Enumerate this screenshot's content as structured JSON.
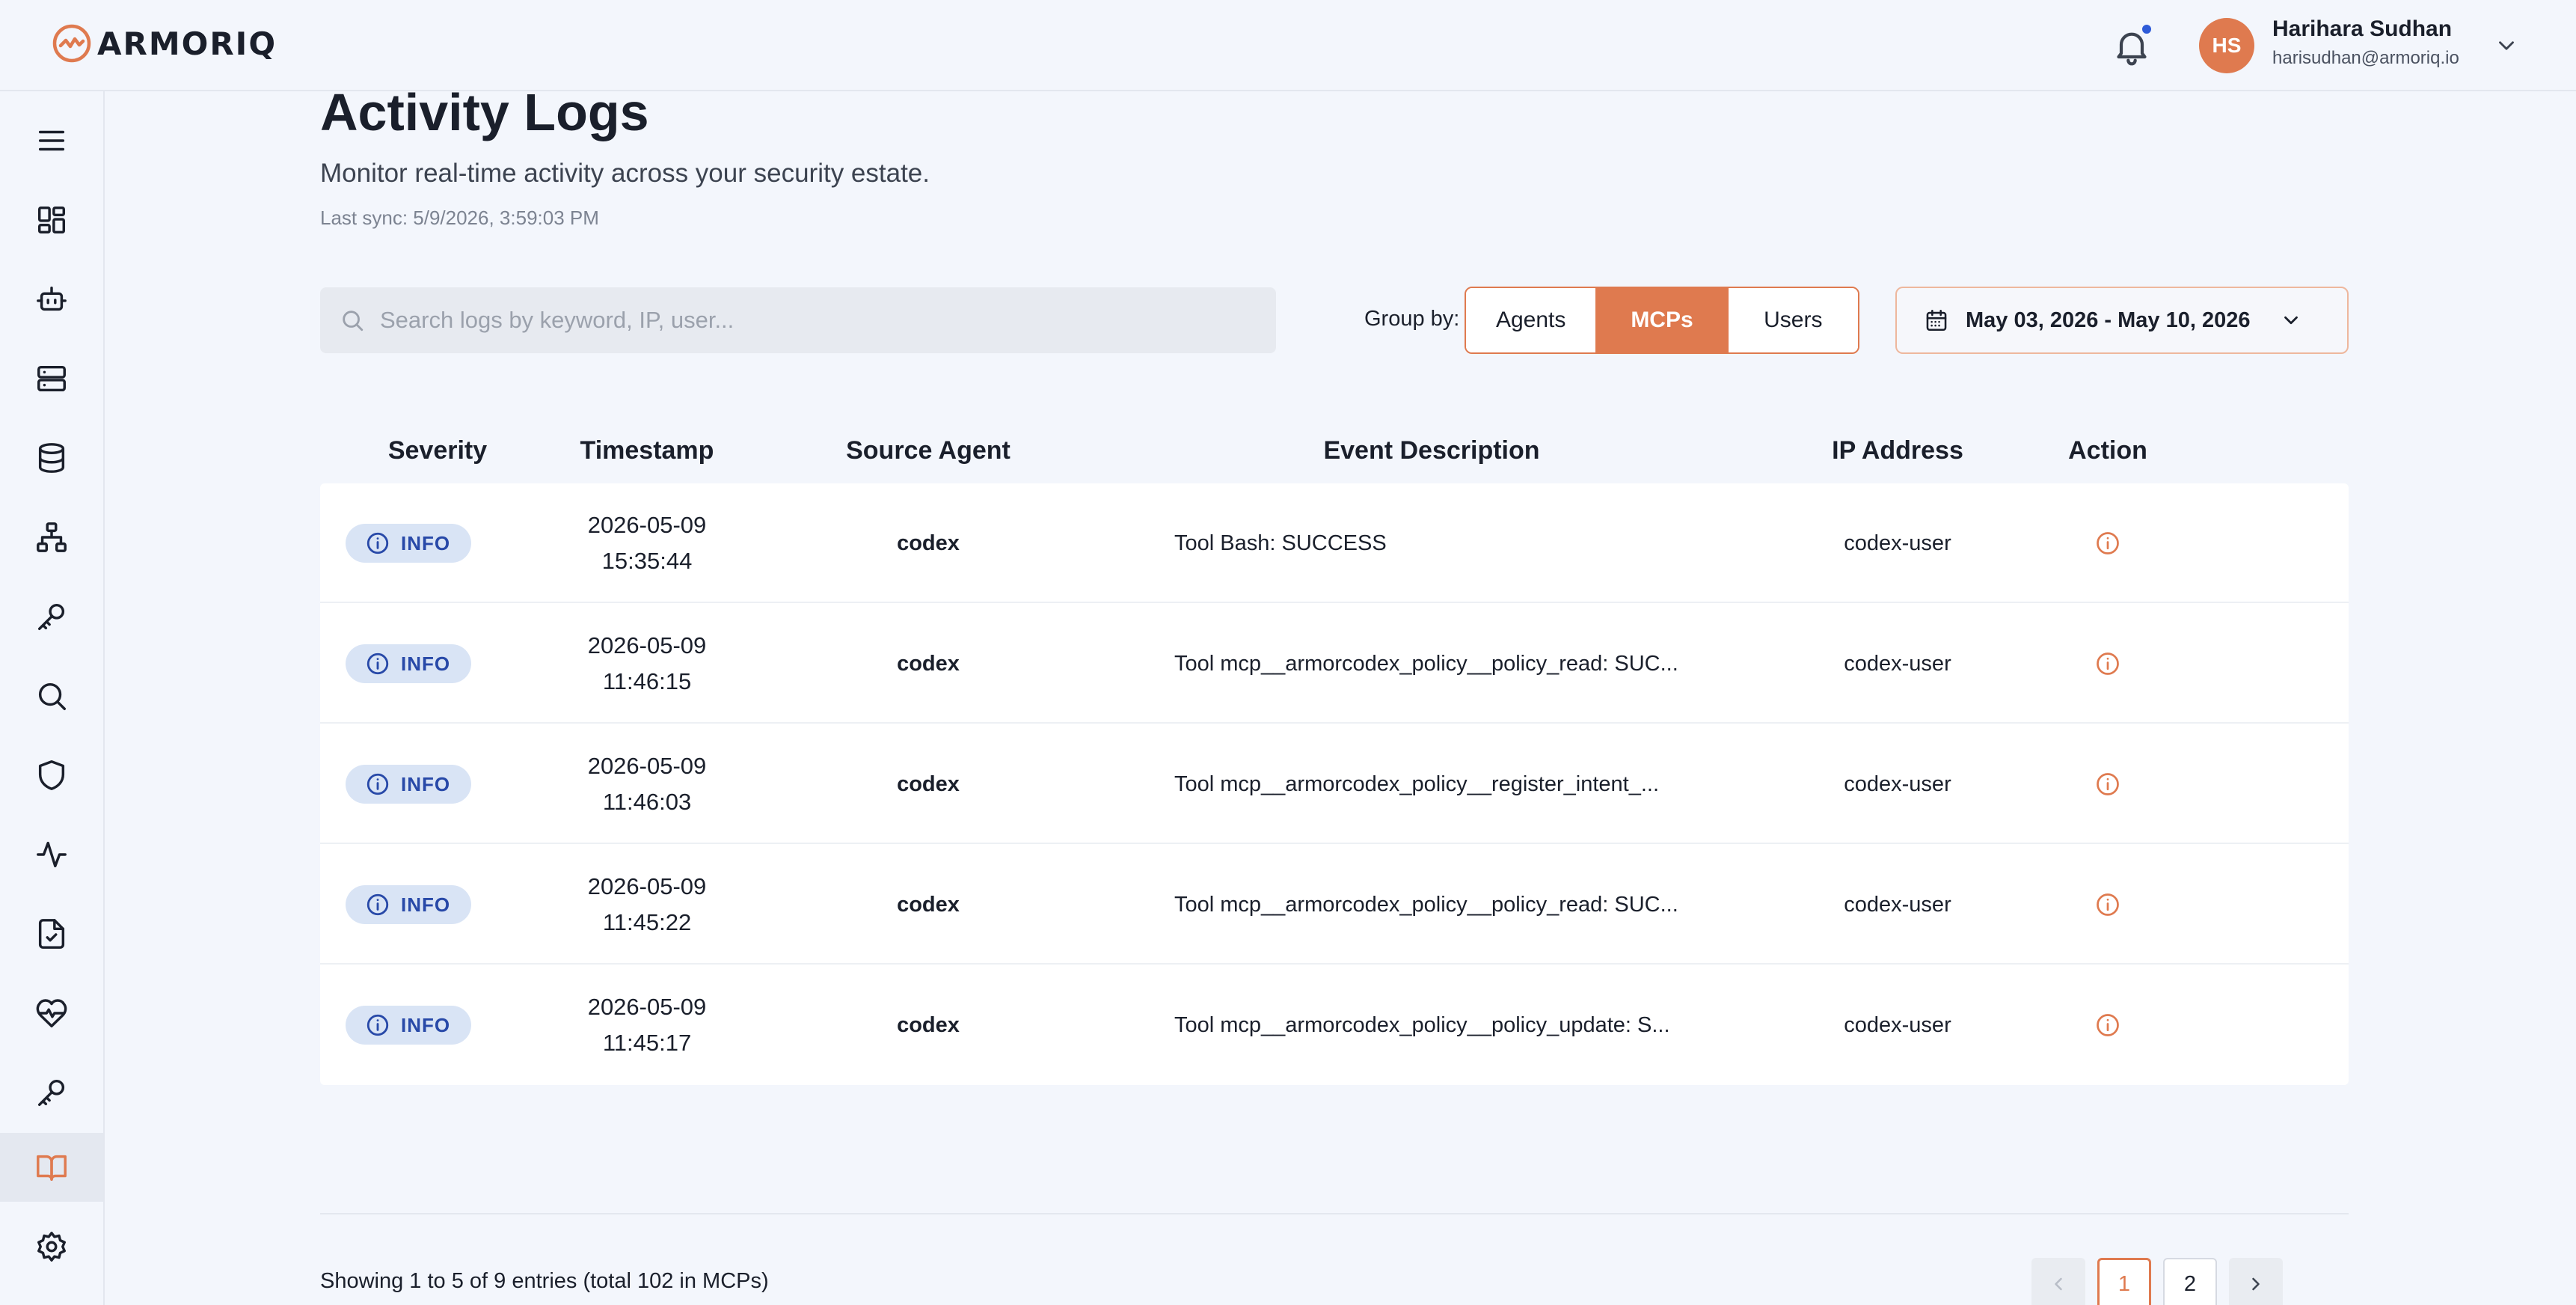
{
  "brand": {
    "name": "ARMORIQ",
    "accent_color": "#df7a4f",
    "info_color": "#2849a8",
    "notification_dot_color": "#2e5bd8"
  },
  "user": {
    "initials": "HS",
    "name": "Harihara Sudhan",
    "email": "harisudhan@armoriq.io"
  },
  "sidebar": {
    "items": [
      {
        "icon": "menu-icon"
      },
      {
        "icon": "dashboard-icon"
      },
      {
        "icon": "robot-icon"
      },
      {
        "icon": "server-icon"
      },
      {
        "icon": "database-icon"
      },
      {
        "icon": "network-icon"
      },
      {
        "icon": "key-icon"
      },
      {
        "icon": "search-icon"
      },
      {
        "icon": "shield-icon"
      },
      {
        "icon": "activity-icon"
      },
      {
        "icon": "file-check-icon"
      },
      {
        "icon": "heart-pulse-icon"
      },
      {
        "icon": "key-icon"
      },
      {
        "icon": "book-open-icon",
        "active": true
      },
      {
        "icon": "gear-icon"
      }
    ]
  },
  "page": {
    "title": "Activity Logs",
    "subtitle": "Monitor real-time activity across your security estate.",
    "last_sync": "Last sync: 5/9/2026, 3:59:03 PM"
  },
  "search": {
    "placeholder": "Search logs by keyword, IP, user...",
    "value": ""
  },
  "group_by": {
    "label": "Group by:",
    "options": [
      "Agents",
      "MCPs",
      "Users"
    ],
    "selected": "MCPs"
  },
  "date_range": {
    "value": "May 03, 2026 - May 10, 2026"
  },
  "table": {
    "columns": [
      "Severity",
      "Timestamp",
      "Source Agent",
      "Event Description",
      "IP Address",
      "Action"
    ],
    "rows": [
      {
        "severity": "INFO",
        "date": "2026-05-09",
        "time": "15:35:44",
        "source": "codex",
        "description": "Tool Bash: SUCCESS",
        "ip": "codex-user"
      },
      {
        "severity": "INFO",
        "date": "2026-05-09",
        "time": "11:46:15",
        "source": "codex",
        "description": "Tool mcp__armorcodex_policy__policy_read: SUC...",
        "ip": "codex-user"
      },
      {
        "severity": "INFO",
        "date": "2026-05-09",
        "time": "11:46:03",
        "source": "codex",
        "description": "Tool mcp__armorcodex_policy__register_intent_...",
        "ip": "codex-user"
      },
      {
        "severity": "INFO",
        "date": "2026-05-09",
        "time": "11:45:22",
        "source": "codex",
        "description": "Tool mcp__armorcodex_policy__policy_read: SUC...",
        "ip": "codex-user"
      },
      {
        "severity": "INFO",
        "date": "2026-05-09",
        "time": "11:45:17",
        "source": "codex",
        "description": "Tool mcp__armorcodex_policy__policy_update: S...",
        "ip": "codex-user"
      }
    ]
  },
  "footer": {
    "showing": "Showing 1 to 5 of 9 entries (total 102 in MCPs)",
    "pages": [
      "1",
      "2"
    ],
    "current_page": "1"
  }
}
